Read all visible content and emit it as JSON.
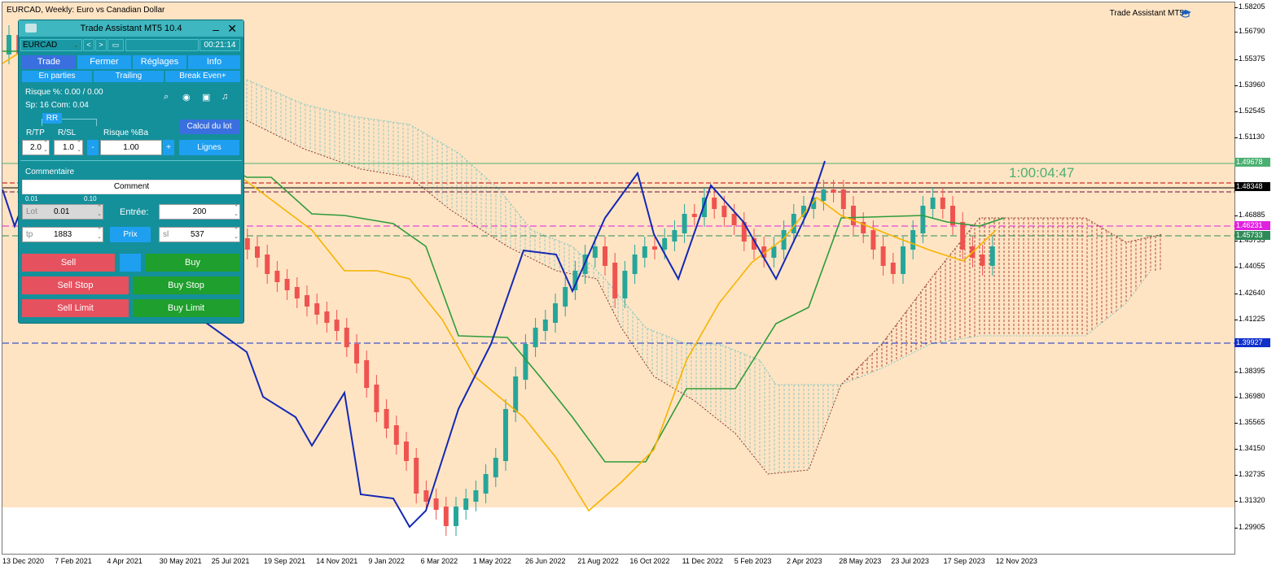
{
  "chart": {
    "title": "EURCAD, Weekly:  Euro vs Canadian Dollar",
    "assistant_label": "Trade Assistant MT5",
    "countdown": "1:00:04:47",
    "price_ticks": [
      "1.58205",
      "1.56790",
      "1.55375",
      "1.53960",
      "1.52545",
      "1.51130",
      "1.49678",
      "1.48348",
      "1.46885",
      "1.45733",
      "1.44055",
      "1.42640",
      "1.41225",
      "1.39927",
      "1.38395",
      "1.36980",
      "1.35565",
      "1.34150",
      "1.32735",
      "1.31320",
      "1.29905"
    ],
    "price_tags": [
      {
        "label": "1.49678",
        "color": "#4caf72"
      },
      {
        "label": "1.48348",
        "color": "#000000"
      },
      {
        "label": "1.46231",
        "color": "#e020e0"
      },
      {
        "label": "1.45733",
        "color": "#2e8b57"
      },
      {
        "label": "1.39927",
        "color": "#1030c8"
      }
    ],
    "time_ticks": [
      "13 Dec 2020",
      "7 Feb 2021",
      "4 Apr 2021",
      "30 May 2021",
      "25 Jul 2021",
      "19 Sep 2021",
      "14 Nov 2021",
      "9 Jan 2022",
      "6 Mar 2022",
      "1 May 2022",
      "26 Jun 2022",
      "21 Aug 2022",
      "16 Oct 2022",
      "11 Dec 2022",
      "5 Feb 2023",
      "2 Apr 2023",
      "28 May 2023",
      "23 Jul 2023",
      "17 Sep 2023",
      "12 Nov 2023"
    ],
    "colors": {
      "bull": "#26a69a",
      "bear": "#ef5350",
      "tenkan": "#f5b400",
      "kijun": "#2e9b3a",
      "chikou": "#1428b4",
      "background": "#ffe4c4"
    }
  },
  "panel": {
    "title": "Trade Assistant MT5 10.4",
    "symbol": "EURCAD",
    "timer": "00:21:14",
    "tabs": [
      "Trade",
      "Fermer",
      "Réglages",
      "Info"
    ],
    "subtabs": [
      "En parties",
      "Trailing",
      "Break Even+"
    ],
    "risk_line": "Risque %: 0.00 /  0.00",
    "spread_line": "Sp: 16  Com: 0.04",
    "rr_label": "RR",
    "rtp_label": "R/TP",
    "rsl_label": "R/SL",
    "risk_ba_label": "Risque %Ba",
    "calc_button": "Calcul du lot",
    "rtp_value": "2.0",
    "rsl_value": "1.0",
    "minus": "-",
    "plus": "+",
    "risk_value": "1.00",
    "lines_button": "Lignes",
    "comment_label": "Commentaire",
    "comment_value": "Comment",
    "lot_min": "0.01",
    "lot_step": "0.10",
    "lot_label": "Lot",
    "lot_value": "0.01",
    "entry_label": "Entrée:",
    "entry_value": "200",
    "tp_label": "tp",
    "tp_value": "1883",
    "price_button": "Prix",
    "sl_label": "sl",
    "sl_value": "537",
    "sell": "Sell",
    "buy": "Buy",
    "sell_stop": "Sell Stop",
    "buy_stop": "Buy Stop",
    "sell_limit": "Sell Limit",
    "buy_limit": "Buy Limit"
  }
}
